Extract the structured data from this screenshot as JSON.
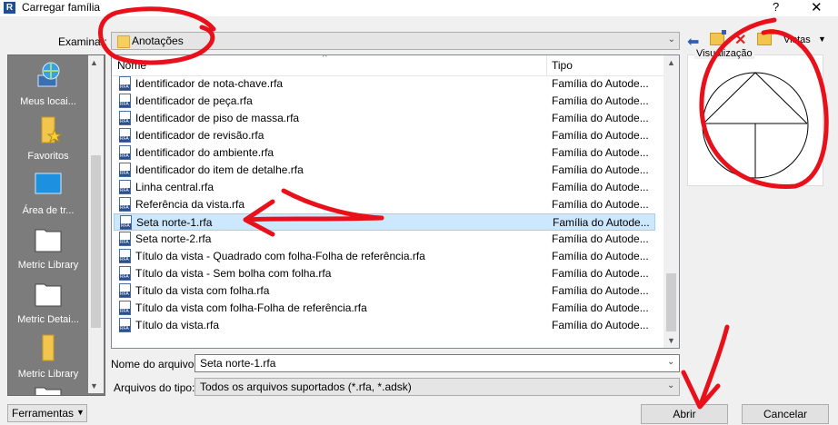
{
  "window": {
    "title": "Carregar família",
    "help": "?",
    "close": "✕"
  },
  "lookin": {
    "label": "Examinar:",
    "value": "Anotações",
    "views_label": "Vistas"
  },
  "places": [
    {
      "label": "Meus locai...",
      "icon": "globe-computer-icon"
    },
    {
      "label": "Favoritos",
      "icon": "favorites-folder-icon"
    },
    {
      "label": "Área de tr...",
      "icon": "desktop-icon"
    },
    {
      "label": "Metric Library",
      "icon": "folder-icon"
    },
    {
      "label": "Metric Detai...",
      "icon": "folder-icon"
    },
    {
      "label": "Metric Library",
      "icon": "folder-icon"
    },
    {
      "label": "",
      "icon": "folder-icon"
    }
  ],
  "filelist": {
    "columns": [
      "Nome",
      "Tipo"
    ],
    "selected_index": 8,
    "rows": [
      {
        "name": "Identificador de nota-chave.rfa",
        "type": "Família do Autode..."
      },
      {
        "name": "Identificador de peça.rfa",
        "type": "Família do Autode..."
      },
      {
        "name": "Identificador de piso de massa.rfa",
        "type": "Família do Autode..."
      },
      {
        "name": "Identificador de revisão.rfa",
        "type": "Família do Autode..."
      },
      {
        "name": "Identificador do ambiente.rfa",
        "type": "Família do Autode..."
      },
      {
        "name": "Identificador do item de detalhe.rfa",
        "type": "Família do Autode..."
      },
      {
        "name": "Linha central.rfa",
        "type": "Família do Autode..."
      },
      {
        "name": "Referência da vista.rfa",
        "type": "Família do Autode..."
      },
      {
        "name": "Seta norte-1.rfa",
        "type": "Família do Autode..."
      },
      {
        "name": "Seta norte-2.rfa",
        "type": "Família do Autode..."
      },
      {
        "name": "Título da vista - Quadrado com folha-Folha de referência.rfa",
        "type": "Família do Autode..."
      },
      {
        "name": "Título da vista - Sem bolha com folha.rfa",
        "type": "Família do Autode..."
      },
      {
        "name": "Título da vista com folha.rfa",
        "type": "Família do Autode..."
      },
      {
        "name": "Título da vista com folha-Folha de referência.rfa",
        "type": "Família do Autode..."
      },
      {
        "name": "Título da vista.rfa",
        "type": "Família do Autode..."
      }
    ]
  },
  "preview": {
    "label": "Visualização"
  },
  "filename": {
    "label": "Nome do arquivo:",
    "value": "Seta norte-1.rfa"
  },
  "filetype": {
    "label": "Arquivos do tipo:",
    "value": "Todos os arquivos suportados  (*.rfa, *.adsk)"
  },
  "buttons": {
    "tools": "Ferramentas",
    "open": "Abrir",
    "cancel": "Cancelar"
  },
  "colors": {
    "selection": "#cce8ff",
    "annotation": "#e8101a",
    "places_bg": "#7c7c7c"
  }
}
